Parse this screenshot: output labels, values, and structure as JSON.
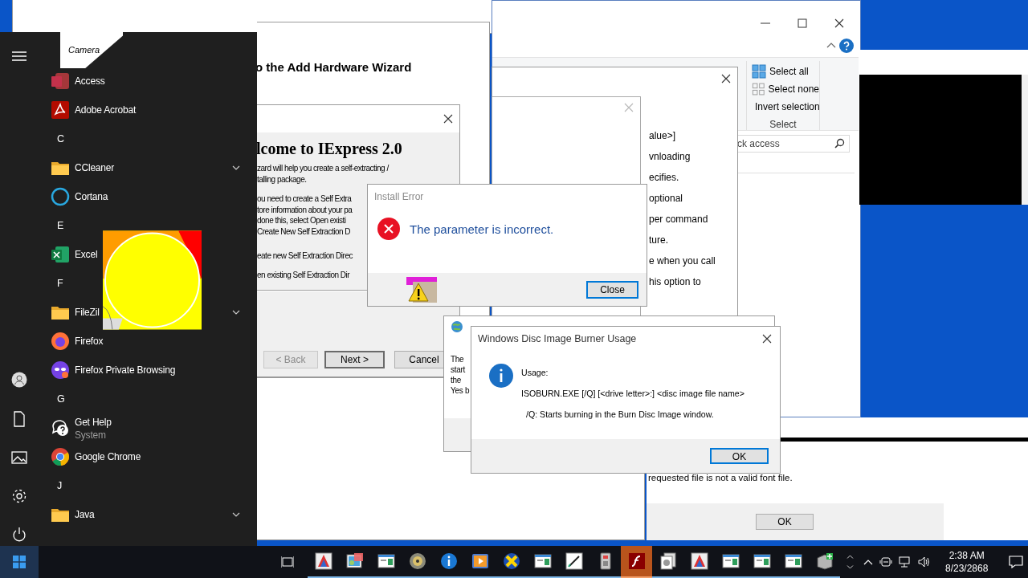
{
  "hardware_wizard": {
    "heading": "o the Add Hardware Wizard"
  },
  "camera_fragment": {
    "label": "Camera"
  },
  "explorer": {
    "select_items": [
      {
        "label": "Select all"
      },
      {
        "label": "Select none"
      },
      {
        "label": "Invert selection"
      }
    ],
    "group_label": "Select",
    "search": {
      "placeholder": "ck access"
    }
  },
  "help_window": {
    "lines": [
      "alue>]",
      "vnloading",
      "ecifies.",
      "optional",
      "per command",
      "ture.",
      "e when you call",
      "his option to"
    ]
  },
  "iexpress": {
    "heading": "lcome to IExpress 2.0",
    "intro_lines": [
      "zard will help you create a self-extracting /",
      "talling package."
    ],
    "detail_lines": [
      "ou need to create a Self Extra",
      "tore information about your pa",
      "done this, select Open existi",
      "Create New Self Extraction D"
    ],
    "options": [
      "eate new Self Extraction Direc",
      "en existing Self Extraction Dir"
    ],
    "buttons": [
      {
        "label": "< Back",
        "disabled": true,
        "default": false
      },
      {
        "label": "Next >",
        "disabled": false,
        "default": true
      },
      {
        "label": "Cancel",
        "disabled": false,
        "default": false
      }
    ]
  },
  "install_error": {
    "title": "Install Error",
    "message": "The parameter is incorrect.",
    "button": "Close"
  },
  "font_error": {
    "message": "requested file is not a valid font file.",
    "button": "OK"
  },
  "iscsi": {
    "lines": [
      "The",
      "start",
      "the",
      "Yes b"
    ]
  },
  "iso_usage": {
    "title": "Windows Disc Image Burner Usage",
    "lines": [
      {
        "text": "Usage:",
        "indented": false
      },
      {
        "text": "ISOBURN.EXE [/Q] [<drive letter>:] <disc image file name>",
        "indented": false
      },
      {
        "text": "/Q: Starts burning in the Burn Disc Image window.",
        "indented": true
      }
    ],
    "button": "OK"
  },
  "start_menu": {
    "entries": [
      {
        "kind": "app",
        "label": "Access"
      },
      {
        "kind": "app",
        "label": "Adobe Acrobat"
      },
      {
        "kind": "header",
        "label": "C"
      },
      {
        "kind": "folder",
        "label": "CCleaner",
        "expandable": true
      },
      {
        "kind": "app",
        "label": "Cortana"
      },
      {
        "kind": "header",
        "label": "E"
      },
      {
        "kind": "app",
        "label": "Excel"
      },
      {
        "kind": "header",
        "label": "F"
      },
      {
        "kind": "folder",
        "label": "FileZil",
        "expandable": true
      },
      {
        "kind": "app",
        "label": "Firefox"
      },
      {
        "kind": "app",
        "label": "Firefox Private Browsing"
      },
      {
        "kind": "header",
        "label": "G"
      },
      {
        "kind": "app",
        "label": "Get Help",
        "subtitle": "System"
      },
      {
        "kind": "app",
        "label": "Google Chrome"
      },
      {
        "kind": "header",
        "label": "J"
      },
      {
        "kind": "folder",
        "label": "Java",
        "expandable": true
      }
    ]
  },
  "taskbar": {
    "apps": [
      {
        "active": false
      },
      {
        "active": false
      },
      {
        "active": false
      },
      {
        "active": false
      },
      {
        "active": false
      },
      {
        "active": false
      },
      {
        "active": false
      },
      {
        "active": false
      },
      {
        "active": false
      },
      {
        "active": false
      },
      {
        "active": true
      },
      {
        "active": false
      },
      {
        "active": false
      },
      {
        "active": false
      },
      {
        "active": false
      },
      {
        "active": false
      },
      {
        "active": false
      }
    ],
    "clock": {
      "time": "2:38 AM",
      "date": "8/23/2868"
    }
  }
}
